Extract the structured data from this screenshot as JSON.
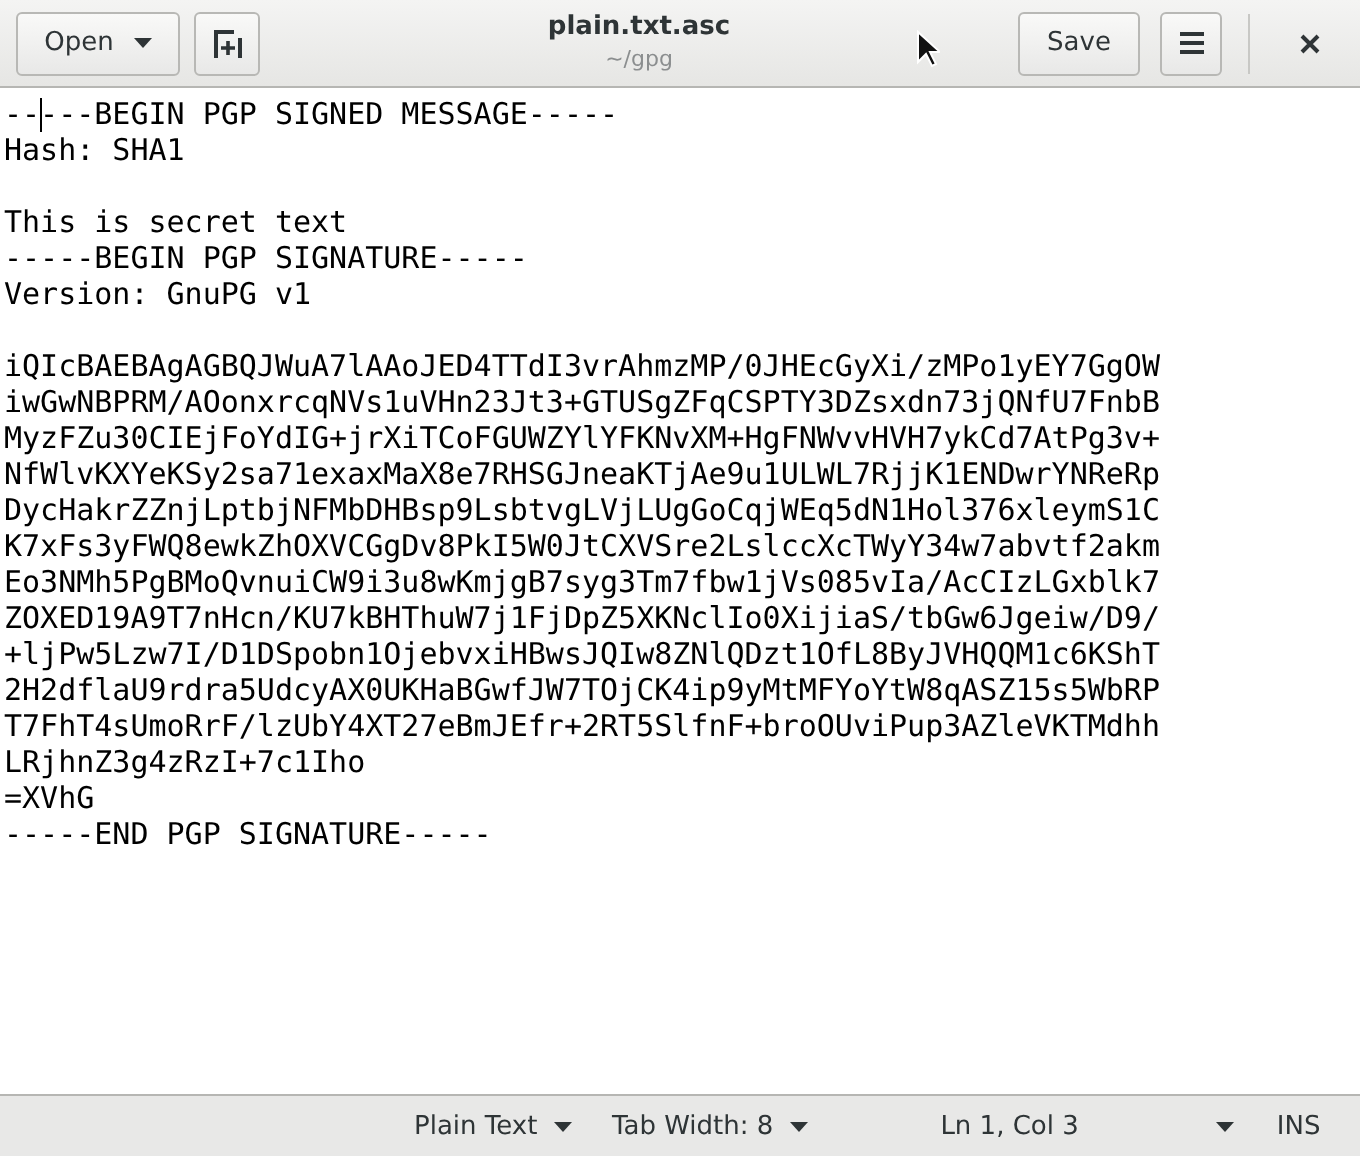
{
  "header": {
    "open_button": "Open",
    "title": "plain.txt.asc",
    "subtitle": "~/gpg",
    "save_button": "Save"
  },
  "editor": {
    "blocks": [
      [
        "-----BEGIN PGP SIGNED MESSAGE-----",
        "Hash: SHA1"
      ],
      [
        "This is secret text",
        "-----BEGIN PGP SIGNATURE-----",
        "Version: GnuPG v1"
      ],
      [
        "iQIcBAEBAgAGBQJWuA7lAAoJED4TTdI3vrAhmzMP/0JHEcGyXi/zMPo1yEY7GgOW",
        "iwGwNBPRM/AOonxrcqNVs1uVHn23Jt3+GTUSgZFqCSPTY3DZsxdn73jQNfU7FnbB",
        "MyzFZu30CIEjFoYdIG+jrXiTCoFGUWZYlYFKNvXM+HgFNWvvHVH7ykCd7AtPg3v+",
        "NfWlvKXYeKSy2sa71exaxMaX8e7RHSGJneaKTjAe9u1ULWL7RjjK1ENDwrYNReRp",
        "DycHakrZZnjLptbjNFMbDHBsp9LsbtvgLVjLUgGoCqjWEq5dN1Hol376xleymS1C",
        "K7xFs3yFWQ8ewkZhOXVCGgDv8PkI5W0JtCXVSre2LslccXcTWyY34w7abvtf2akm",
        "Eo3NMh5PgBMoQvnuiCW9i3u8wKmjgB7syg3Tm7fbw1jVs085vIa/AcCIzLGxblk7",
        "ZOXED19A9T7nHcn/KU7kBHThuW7j1FjDpZ5XKNclIo0XijiaS/tbGw6Jgeiw/D9/",
        "+ljPw5Lzw7I/D1DSpobn1OjebvxiHBwsJQIw8ZNlQDzt1OfL8ByJVHQQM1c6KShT",
        "2H2dflaU9rdra5UdcyAX0UKHaBGwfJW7TOjCK4ip9yMtMFYoYtW8qASZ15s5WbRP",
        "T7FhT4sUmoRrF/lzUbY4XT27eBmJEfr+2RT5SlfnF+broOUviPup3AZleVKTMdhh",
        "LRjhnZ3g4zRzI+7c1Iho",
        "=XVhG",
        "-----END PGP SIGNATURE-----"
      ]
    ]
  },
  "status_bar": [
    {
      "kind": "dropdown",
      "label": "Plain Text"
    },
    {
      "kind": "dropdown",
      "label": "Tab Width: 8"
    },
    {
      "kind": "text",
      "label": "Ln 1, Col 3"
    },
    {
      "kind": "caret"
    },
    {
      "kind": "text",
      "label": "INS"
    }
  ]
}
